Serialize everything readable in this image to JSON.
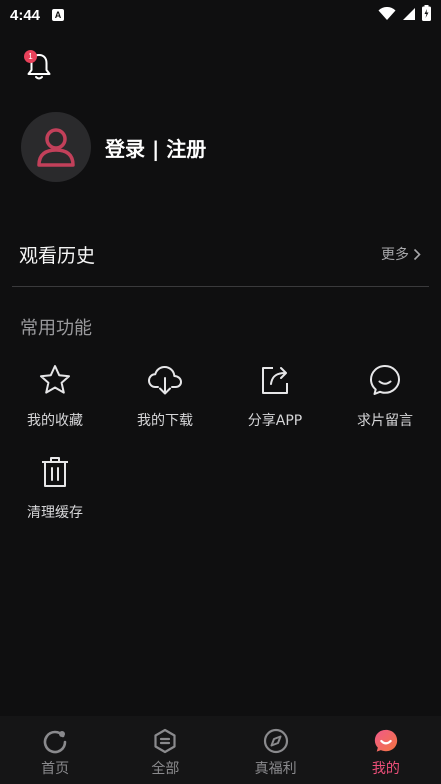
{
  "status": {
    "time": "4:44",
    "app_icon_letter": "A"
  },
  "notifications": {
    "badge_count": "1"
  },
  "profile": {
    "login_label": "登录 | 注册"
  },
  "history": {
    "title": "观看历史",
    "more_label": "更多"
  },
  "common": {
    "title": "常用功能",
    "items": [
      {
        "label": "我的收藏",
        "icon": "star-icon"
      },
      {
        "label": "我的下载",
        "icon": "cloud-download-icon"
      },
      {
        "label": "分享APP",
        "icon": "share-icon"
      },
      {
        "label": "求片留言",
        "icon": "message-icon"
      },
      {
        "label": "清理缓存",
        "icon": "trash-icon"
      }
    ]
  },
  "tabs": [
    {
      "label": "首页",
      "icon": "home-icon"
    },
    {
      "label": "全部",
      "icon": "list-icon"
    },
    {
      "label": "真福利",
      "icon": "compass-icon"
    },
    {
      "label": "我的",
      "icon": "profile-icon",
      "active": true
    }
  ],
  "colors": {
    "accent": "#ec4f79",
    "background": "#0f0f10",
    "badge": "#e8415a",
    "avatar_figure": "#c2405a"
  }
}
